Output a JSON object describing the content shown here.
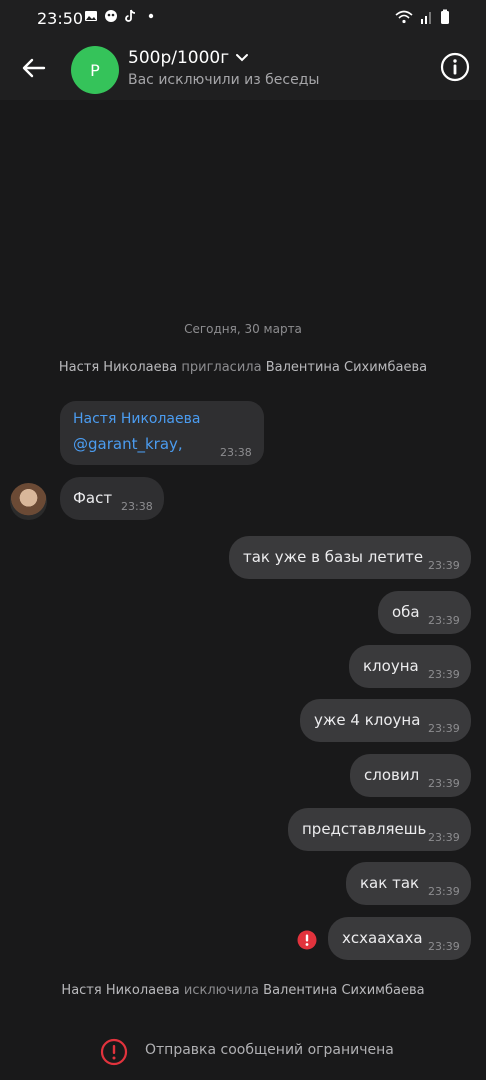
{
  "status": {
    "time": "23:50"
  },
  "header": {
    "avatar_letter": "P",
    "title": "500р/1000г",
    "subtitle": "Вас исключили из беседы"
  },
  "date_separator": "Сегодня, 30 марта",
  "events": {
    "invite": {
      "actor": "Настя Николаева",
      "action": "пригласила",
      "target": "Валентина Сихимбаева"
    },
    "kick": {
      "actor": "Настя Николаева",
      "action": "исключила",
      "target": "Валентина Сихимбаева"
    }
  },
  "incoming": [
    {
      "sender": "Настя Николаева",
      "text": "@garant_kray,",
      "time": "23:38"
    },
    {
      "text": "Фаст",
      "time": "23:38"
    }
  ],
  "outgoing": [
    {
      "text": "так уже в базы летите",
      "time": "23:39"
    },
    {
      "text": "оба",
      "time": "23:39"
    },
    {
      "text": "клоуна",
      "time": "23:39"
    },
    {
      "text": "уже 4 клоуна",
      "time": "23:39"
    },
    {
      "text": "словил",
      "time": "23:39"
    },
    {
      "text": "представляешь",
      "time": "23:39"
    },
    {
      "text": "как так",
      "time": "23:39"
    },
    {
      "text": "хсхаахаха",
      "time": "23:39"
    }
  ],
  "footer": {
    "text": "Отправка сообщений ограничена"
  },
  "colors": {
    "accent": "#4b9cf0",
    "error": "#e2333d",
    "avatar": "#35c35a"
  }
}
